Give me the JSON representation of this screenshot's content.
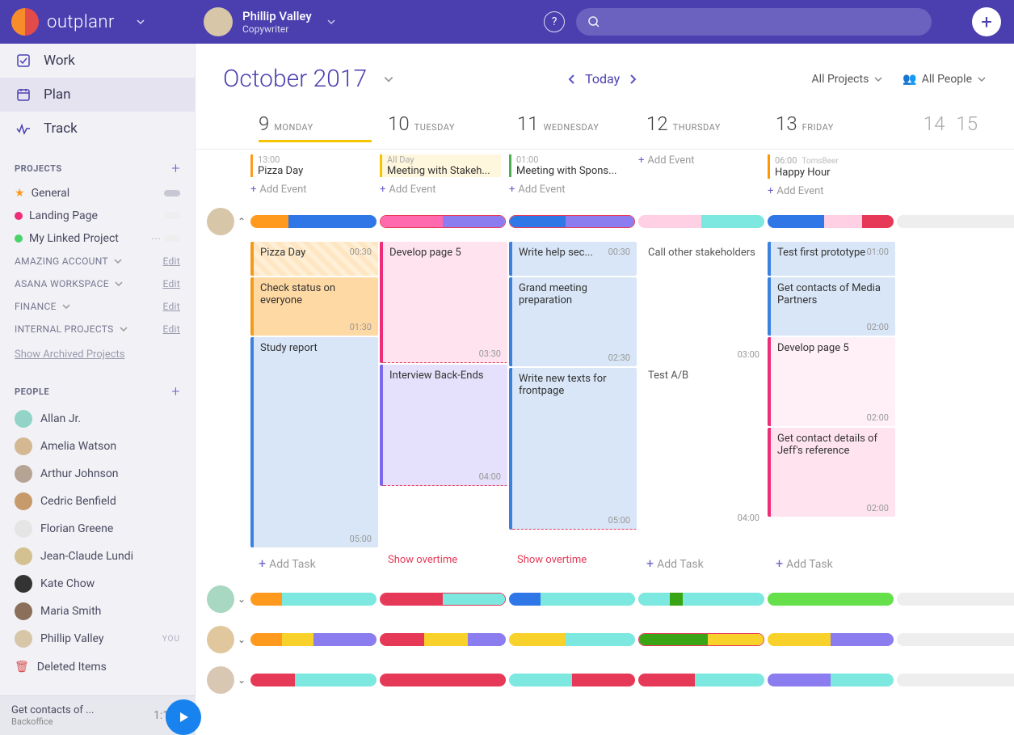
{
  "brand": {
    "name": "outplanr"
  },
  "user": {
    "name": "Phillip Valley",
    "role": "Copywriter"
  },
  "nav": {
    "work": "Work",
    "plan": "Plan",
    "track": "Track"
  },
  "projects": {
    "title": "PROJECTS",
    "items": [
      {
        "name": "General",
        "color": "#ff9a1e",
        "starred": true
      },
      {
        "name": "Landing Page",
        "color": "#ee2d78"
      },
      {
        "name": "My Linked Project",
        "color": "#4bd36b"
      }
    ],
    "accounts": [
      {
        "name": "AMAZING ACCOUNT",
        "edit": "Edit"
      },
      {
        "name": "ASANA WORKSPACE",
        "edit": "Edit"
      },
      {
        "name": "FINANCE",
        "edit": "Edit"
      },
      {
        "name": "INTERNAL PROJECTS",
        "edit": "Edit"
      }
    ],
    "archived": "Show Archived Projects"
  },
  "people": {
    "title": "PEOPLE",
    "list": [
      {
        "name": "Allan Jr."
      },
      {
        "name": "Amelia Watson"
      },
      {
        "name": "Arthur Johnson"
      },
      {
        "name": "Cedric Benfield"
      },
      {
        "name": "Florian Greene"
      },
      {
        "name": "Jean-Claude Lundi"
      },
      {
        "name": "Kate Chow"
      },
      {
        "name": "Maria Smith"
      }
    ],
    "me": {
      "name": "Phillip Valley",
      "badge": "YOU"
    },
    "deleted": "Deleted Items"
  },
  "nowplaying": {
    "title": "Get contacts of ...",
    "project": "Backoffice",
    "elapsed": "1:12"
  },
  "plan": {
    "month": "October 2017",
    "today": "Today",
    "filters": {
      "projects": "All Projects",
      "people": "All People"
    },
    "days": [
      {
        "num": "9",
        "name": "MONDAY",
        "underline": true
      },
      {
        "num": "10",
        "name": "TUESDAY"
      },
      {
        "num": "11",
        "name": "WEDNESDAY"
      },
      {
        "num": "12",
        "name": "THURSDAY"
      },
      {
        "num": "13",
        "name": "FRIDAY"
      }
    ],
    "next": [
      "14",
      "15"
    ],
    "events": {
      "mon": {
        "time": "13:00",
        "title": "Pizza Day"
      },
      "tue": {
        "time": "All Day",
        "title": "Meeting with Stakeh..."
      },
      "wed": {
        "time": "01:00",
        "title": "Meeting with Spons..."
      },
      "thu_add": "Add Event",
      "fri": {
        "time": "06:00",
        "org": "TomsBeer",
        "title": "Happy Hour"
      },
      "add": "Add Event"
    },
    "tasks": {
      "mon": [
        {
          "t": "Pizza Day",
          "d": "00:30",
          "cls": "c-orange-l hatch h1",
          "durTop": true
        },
        {
          "t": "Check status on everyone",
          "d": "01:30",
          "cls": "c-orange-d h2"
        },
        {
          "t": "Study report",
          "d": "05:00",
          "cls": "c-blue-l hbig"
        }
      ],
      "tue": [
        {
          "t": "Develop page 5",
          "d": "03:30",
          "cls": "c-pink-l h4 overtime-bot"
        },
        {
          "t": "Interview Back-Ends",
          "d": "04:00",
          "cls": "c-lav h4 overtime-bot"
        }
      ],
      "wed": [
        {
          "t": "Write help sec...",
          "d": "00:30",
          "cls": "c-blue-l h1",
          "durTop": true
        },
        {
          "t": "Grand meeting preparation",
          "d": "02:30",
          "cls": "c-blue-l h3"
        },
        {
          "t": "Write new texts for frontpage",
          "d": "05:00",
          "cls": "c-blue-l h5 overtime-bot"
        }
      ],
      "thu": [
        {
          "t": "Call other stakeholders",
          "d": "03:00",
          "cls": "c-plain h4"
        },
        {
          "t": "Test A/B",
          "d": "04:00",
          "cls": "c-plain h5"
        }
      ],
      "fri": [
        {
          "t": "Test first prototype",
          "d": "01:00",
          "cls": "c-blue-l h1",
          "durTop": true
        },
        {
          "t": "Get contacts of Media Partners",
          "d": "02:00",
          "cls": "c-blue-l h2"
        },
        {
          "t": "Develop page 5",
          "d": "02:00",
          "cls": "c-pink-vl h3"
        },
        {
          "t": "Get contact details of Jeff's reference",
          "d": "02:00",
          "cls": "c-pink-l h3"
        }
      ],
      "show_overtime": "Show overtime",
      "add_task": "Add Task"
    }
  },
  "colors": {
    "orange": "#ff9a1e",
    "blue": "#2f77e6",
    "pink": "#ee2d78",
    "violet": "#8b7cf0",
    "pale_pink": "#ffcfe3",
    "teal": "#7ce8e0",
    "crimson": "#e63957",
    "yellow": "#f8d22a",
    "green": "#3aa514",
    "lime": "#65e04b"
  }
}
